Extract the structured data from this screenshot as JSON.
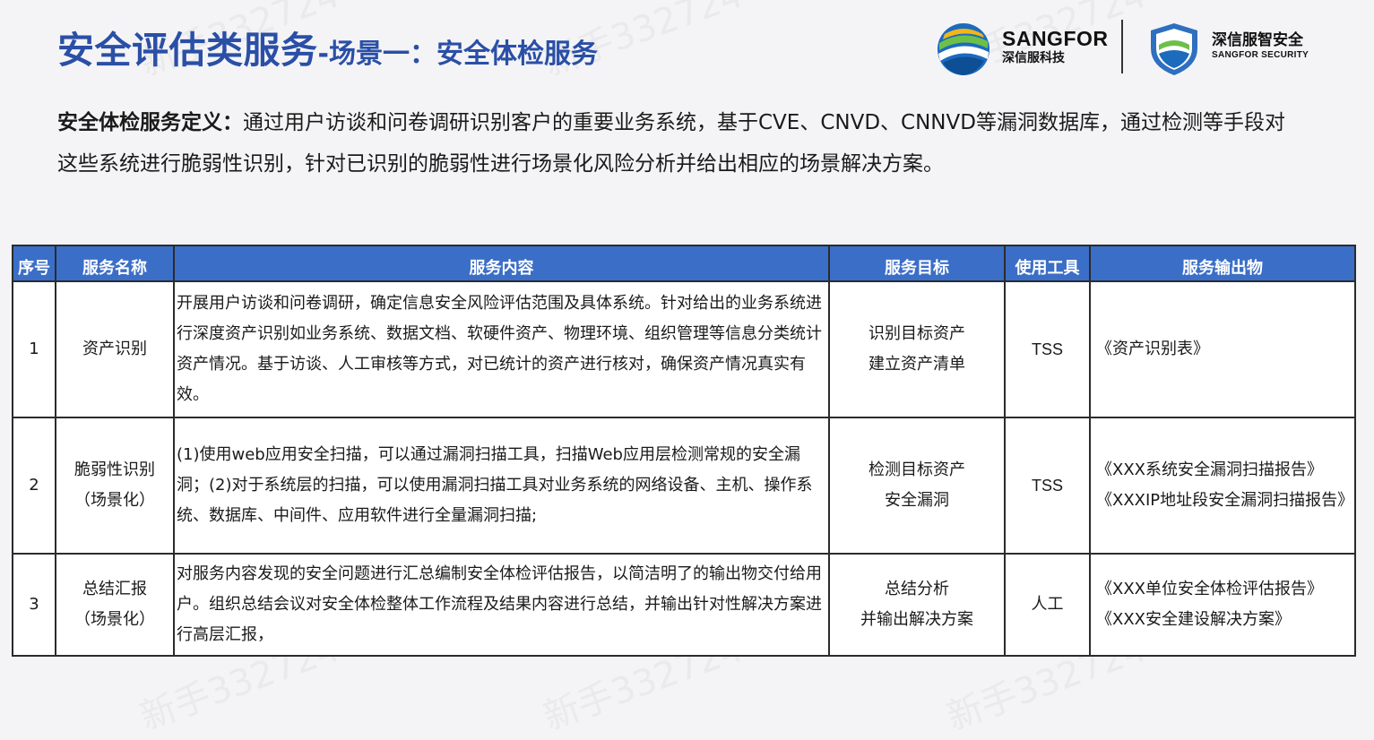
{
  "header": {
    "title_main": "安全评估类服务",
    "title_sub": "-场景一：安全体检服务"
  },
  "logos": {
    "brand1_en": "SANGFOR",
    "brand1_cn": "深信服科技",
    "brand2_cn": "深信服智安全",
    "brand2_en": "SANGFOR SECURITY"
  },
  "definition": {
    "label": "安全体检服务定义：",
    "text": "通过用户访谈和问卷调研识别客户的重要业务系统，基于CVE、CNVD、CNNVD等漏洞数据库，通过检测等手段对这些系统进行脆弱性识别，针对已识别的脆弱性进行场景化风险分析并给出相应的场景解决方案。"
  },
  "table": {
    "headers": [
      "序号",
      "服务名称",
      "服务内容",
      "服务目标",
      "使用工具",
      "服务输出物"
    ],
    "rows": [
      {
        "no": "1",
        "name_line1": "资产识别",
        "name_line2": "",
        "content": "开展用户访谈和问卷调研，确定信息安全风险评估范围及具体系统。针对给出的业务系统进行深度资产识别如业务系统、数据文档、软硬件资产、物理环境、组织管理等信息分类统计资产情况。基于访谈、人工审核等方式，对已统计的资产进行核对，确保资产情况真实有效。",
        "goal_line1": "识别目标资产",
        "goal_line2": "建立资产清单",
        "tool": "TSS",
        "output_line1": "《资产识别表》",
        "output_line2": ""
      },
      {
        "no": "2",
        "name_line1": "脆弱性识别",
        "name_line2": "（场景化）",
        "content": "(1)使用web应用安全扫描，可以通过漏洞扫描工具，扫描Web应用层检测常规的安全漏洞；(2)对于系统层的扫描，可以使用漏洞扫描工具对业务系统的网络设备、主机、操作系统、数据库、中间件、应用软件进行全量漏洞扫描;",
        "goal_line1": "检测目标资产",
        "goal_line2": "安全漏洞",
        "tool": "TSS",
        "output_line1": "《XXX系统安全漏洞扫描报告》",
        "output_line2": "《XXXIP地址段安全漏洞扫描报告》"
      },
      {
        "no": "3",
        "name_line1": "总结汇报",
        "name_line2": "（场景化）",
        "content": "对服务内容发现的安全问题进行汇总编制安全体检评估报告，以简洁明了的输出物交付给用户。组织总结会议对安全体检整体工作流程及结果内容进行总结，并输出针对性解决方案进行高层汇报，",
        "goal_line1": "总结分析",
        "goal_line2": "并输出解决方案",
        "tool": "人工",
        "output_line1": "《XXX单位安全体检评估报告》",
        "output_line2": "《XXX安全建设解决方案》"
      }
    ]
  },
  "watermark": "新手332724",
  "colors": {
    "title": "#2a4fa6",
    "header_bg": "#3b6ec7",
    "header_text": "#ffffff"
  }
}
